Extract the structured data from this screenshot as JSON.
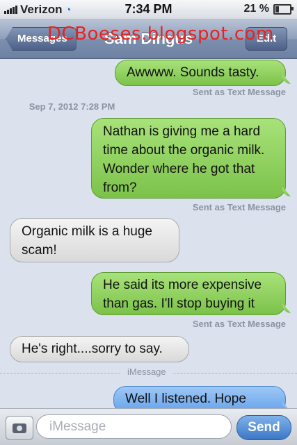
{
  "status": {
    "carrier": "Verizon",
    "time": "7:34 PM",
    "battery": "21 %",
    "battery_level": 0.21
  },
  "nav": {
    "back_label": "Messages",
    "title": "Sam Dingus",
    "edit_label": "Edit"
  },
  "watermark": "DCBoeses.blogspot.com",
  "messages": [
    {
      "text": "Awwww. Sounds tasty.",
      "status": "Sent as Text Message"
    },
    {
      "timestamp": "Sep 7, 2012 7:28 PM"
    },
    {
      "text": "Nathan is giving me a hard time about the organic milk. Wonder where he got that from?",
      "status": "Sent as Text Message"
    },
    {
      "text": "Organic milk is a huge scam!"
    },
    {
      "text": "He said its more expensive than gas. I'll stop buying it",
      "status": "Sent as Text Message"
    },
    {
      "text": "He's right....sorry to say."
    },
    {
      "divider": "iMessage"
    },
    {
      "text": "Well I listened. Hope"
    }
  ],
  "input": {
    "placeholder": "iMessage",
    "send_label": "Send"
  }
}
